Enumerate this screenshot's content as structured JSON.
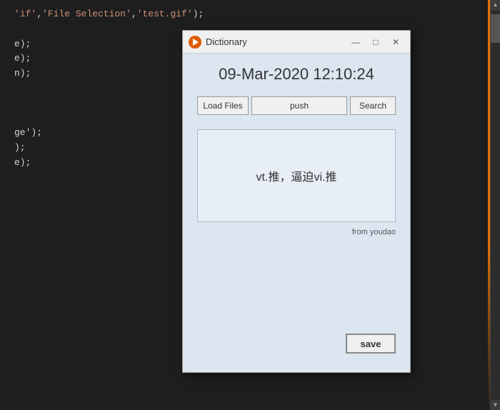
{
  "code": {
    "lines": [
      {
        "text": "if','File Selection','test.gif');"
      },
      {
        "text": ""
      },
      {
        "text": "e);"
      },
      {
        "text": "e);"
      },
      {
        "text": "n);"
      },
      {
        "text": ""
      },
      {
        "text": ""
      },
      {
        "text": ""
      },
      {
        "text": "ge');"
      },
      {
        "text": ");"
      },
      {
        "text": "e);"
      }
    ]
  },
  "dialog": {
    "title": "Dictionary",
    "datetime": "09-Mar-2020 12:10:24",
    "buttons": {
      "load": "Load Files",
      "push": "push",
      "search": "Search"
    },
    "definition": "vt.推，逼迫vi.推",
    "source": "from youdao",
    "save_label": "save"
  },
  "window_controls": {
    "minimize": "—",
    "maximize": "□",
    "close": "✕"
  }
}
